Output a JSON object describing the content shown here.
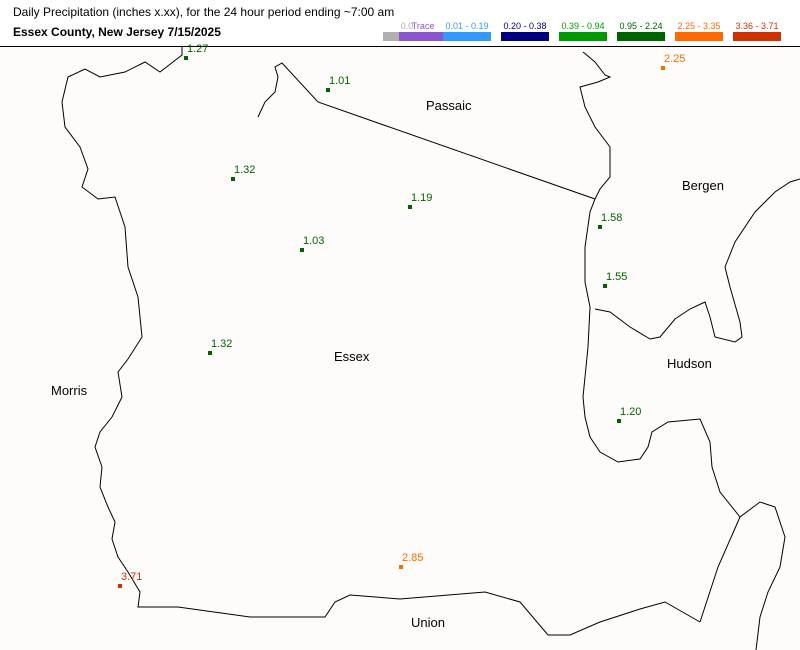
{
  "header": {
    "title": "Daily Precipitation (inches  x.xx),  for the 24 hour period ending ~7:00 am",
    "subtitle": "Essex County, New Jersey  7/15/2025"
  },
  "legend": [
    {
      "label": "0.0",
      "color": "#b0b0b0"
    },
    {
      "label": "Trace",
      "color": "#8855cc"
    },
    {
      "label": "0.01 - 0.19",
      "color": "#3399ff"
    },
    {
      "label": "0.20 - 0.38",
      "color": "#00007f"
    },
    {
      "label": "0.39 - 0.94",
      "color": "#009a00"
    },
    {
      "label": "0.95 - 2.24",
      "color": "#006400"
    },
    {
      "label": "2.25 - 3.35",
      "color": "#ff6a00"
    },
    {
      "label": "3.36 - 3.71",
      "color": "#cc3300"
    }
  ],
  "counties": [
    "Passaic",
    "Bergen",
    "Essex",
    "Morris",
    "Hudson",
    "Union"
  ],
  "stations": [
    {
      "value": "1.27",
      "color": "#006400"
    },
    {
      "value": "1.01",
      "color": "#006400"
    },
    {
      "value": "2.25",
      "color": "#ff6a00"
    },
    {
      "value": "1.32",
      "color": "#006400"
    },
    {
      "value": "1.19",
      "color": "#006400"
    },
    {
      "value": "1.58",
      "color": "#006400"
    },
    {
      "value": "1.03",
      "color": "#006400"
    },
    {
      "value": "1.55",
      "color": "#006400"
    },
    {
      "value": "1.32",
      "color": "#006400"
    },
    {
      "value": "1.20",
      "color": "#006400"
    },
    {
      "value": "2.85",
      "color": "#ff6a00"
    },
    {
      "value": "3.71",
      "color": "#cc3300"
    }
  ]
}
